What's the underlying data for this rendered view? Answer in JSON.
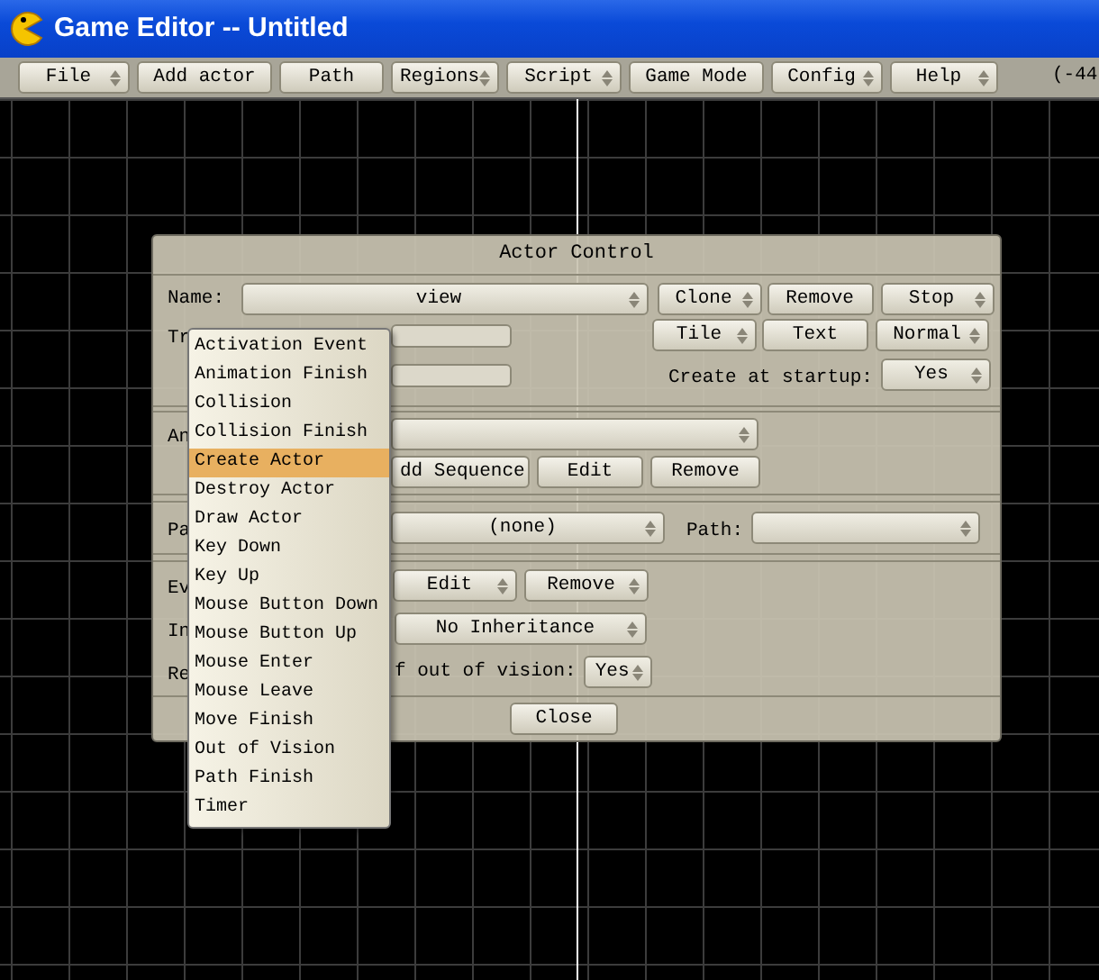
{
  "window": {
    "title": "Game Editor -- Untitled"
  },
  "menu_bar": {
    "items": [
      {
        "label": "File",
        "dropdown": true
      },
      {
        "label": "Add actor",
        "dropdown": false
      },
      {
        "label": "Path",
        "dropdown": false
      },
      {
        "label": "Regions",
        "dropdown": true
      },
      {
        "label": "Script",
        "dropdown": true
      },
      {
        "label": "Game Mode",
        "dropdown": false
      },
      {
        "label": "Config",
        "dropdown": true
      },
      {
        "label": "Help",
        "dropdown": true
      }
    ],
    "coordinates": "(-44"
  },
  "dialog": {
    "title": "Actor Control",
    "name_label": "Name:",
    "name_value": "view",
    "top_buttons": [
      {
        "label": "Clone",
        "dropdown": true
      },
      {
        "label": "Remove",
        "dropdown": false
      },
      {
        "label": "Stop",
        "dropdown": true
      },
      {
        "label": "Tile",
        "dropdown": true
      },
      {
        "label": "Text",
        "dropdown": false
      },
      {
        "label": "Normal",
        "dropdown": true
      }
    ],
    "transparency_label": "Tr",
    "create_at_startup_label": "Create at startup:",
    "create_at_startup_value": "Yes",
    "animation_label": "An",
    "animation_buttons": [
      {
        "label": "dd Sequence",
        "dropdown": false
      },
      {
        "label": "Edit",
        "dropdown": false
      },
      {
        "label": "Remove",
        "dropdown": false
      }
    ],
    "path_row_label": "Pa",
    "path_start_value": "(none)",
    "path_label": "Path:",
    "events_label": "Ev",
    "events_buttons": [
      {
        "label": "Edit",
        "dropdown": true
      },
      {
        "label": "Remove",
        "dropdown": true
      }
    ],
    "inherit_label": "In",
    "inherit_value": "No Inheritance",
    "vision_label": "Re",
    "vision_text": "f out of vision:",
    "vision_value": "Yes",
    "close_button": "Close"
  },
  "popup_menu": {
    "items": [
      {
        "label": "Activation Event",
        "selected": false
      },
      {
        "label": "Animation Finish",
        "selected": false
      },
      {
        "label": "Collision",
        "selected": false
      },
      {
        "label": "Collision Finish",
        "selected": false
      },
      {
        "label": "Create Actor",
        "selected": true
      },
      {
        "label": "Destroy Actor",
        "selected": false
      },
      {
        "label": "Draw Actor",
        "selected": false
      },
      {
        "label": "Key Down",
        "selected": false
      },
      {
        "label": "Key Up",
        "selected": false
      },
      {
        "label": "Mouse Button Down",
        "selected": false
      },
      {
        "label": "Mouse Button Up",
        "selected": false
      },
      {
        "label": "Mouse Enter",
        "selected": false
      },
      {
        "label": "Mouse Leave",
        "selected": false
      },
      {
        "label": "Move Finish",
        "selected": false
      },
      {
        "label": "Out of Vision",
        "selected": false
      },
      {
        "label": "Path Finish",
        "selected": false
      },
      {
        "label": "Timer",
        "selected": false
      }
    ]
  }
}
